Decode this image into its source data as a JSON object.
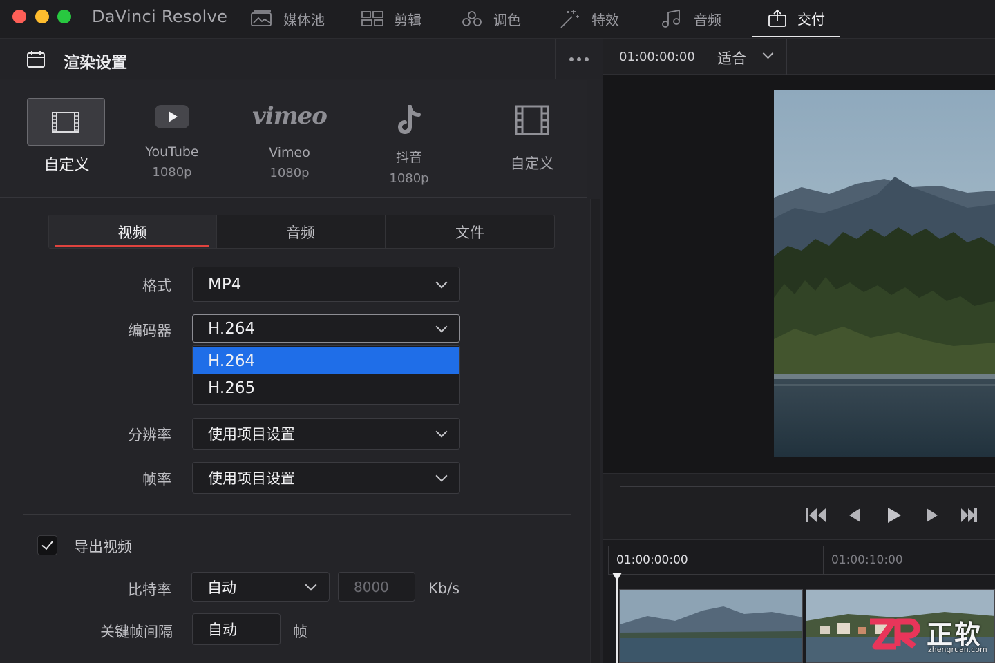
{
  "app": {
    "title": "DaVinci Resolve"
  },
  "nav": {
    "tabs": [
      {
        "label": "媒体池",
        "icon": "media-pool-icon"
      },
      {
        "label": "剪辑",
        "icon": "edit-icon"
      },
      {
        "label": "调色",
        "icon": "color-icon"
      },
      {
        "label": "特效",
        "icon": "effects-icon"
      },
      {
        "label": "音频",
        "icon": "audio-icon"
      },
      {
        "label": "交付",
        "icon": "deliver-icon",
        "active": true
      }
    ]
  },
  "panel": {
    "title": "渲染设置",
    "presets": [
      {
        "label": "自定义",
        "selected": true
      },
      {
        "label": "YouTube",
        "sub": "1080p"
      },
      {
        "label": "Vimeo",
        "sub": "1080p",
        "logo": "vimeo"
      },
      {
        "label": "抖音",
        "sub": "1080p"
      },
      {
        "label": "自定义"
      }
    ],
    "tabs": [
      "视频",
      "音频",
      "文件"
    ],
    "active_tab": "视频",
    "fields": {
      "format_label": "格式",
      "format_value": "MP4",
      "codec_label": "编码器",
      "codec_value": "H.264",
      "codec_options": [
        "H.264",
        "H.265"
      ],
      "resolution_label": "分辨率",
      "resolution_value": "使用项目设置",
      "framerate_label": "帧率",
      "framerate_value": "使用项目设置"
    },
    "export_video_label": "导出视频",
    "export_video_checked": true,
    "bitrate_label": "比特率",
    "bitrate_mode": "自动",
    "bitrate_value": "8000",
    "bitrate_unit": "Kb/s",
    "keyframe_label": "关键帧间隔",
    "keyframe_value": "自动",
    "keyframe_unit": "帧"
  },
  "viewer": {
    "timecode": "01:00:00:00",
    "zoom": "适合"
  },
  "timeline": {
    "timecodes": [
      "01:00:00:00",
      "01:00:10:00"
    ]
  },
  "watermark": {
    "text": "正软",
    "site": "zhengruan.com"
  },
  "colors": {
    "accent_blue": "#1f6ee8",
    "tab_underline": "#e0433e"
  }
}
